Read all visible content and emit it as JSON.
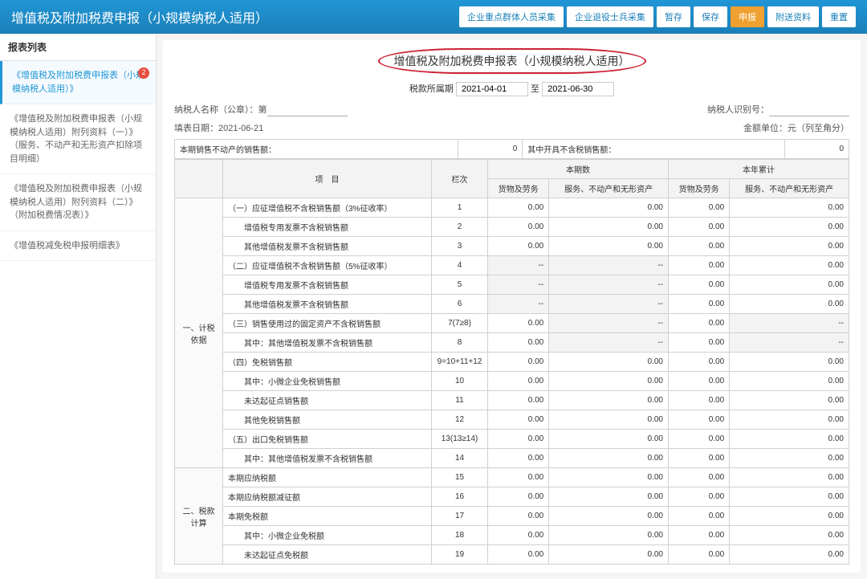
{
  "header": {
    "title": "增值税及附加税费申报（小规模纳税人适用）",
    "actions": [
      "企业重点群体人员采集",
      "企业退役士兵采集",
      "暂存",
      "保存",
      "申报",
      "附送资料",
      "重置"
    ]
  },
  "sidebar": {
    "head": "报表列表",
    "items": [
      {
        "label": "《增值税及附加税费申报表（小规模纳税人适用）》",
        "active": true,
        "badge": "2"
      },
      {
        "label": "《增值税及附加税费申报表（小规模纳税人适用）附列资料（一）》（服务、不动产和无形资产扣除项目明细）"
      },
      {
        "label": "《增值税及附加税费申报表（小规模纳税人适用）附列资料（二）》（附加税费情况表）》"
      },
      {
        "label": "《增值税减免税申报明细表》"
      }
    ]
  },
  "form": {
    "title": "增值税及附加税费申报表（小规模纳税人适用）",
    "period_label": "税款所属期",
    "period_from": "2021-04-01",
    "to": "至",
    "period_to": "2021-06-30",
    "taxpayer_name_label": "纳税人名称（公章）：第",
    "taxpayer_name": "",
    "taxpayer_id_label": "纳税人识别号：",
    "fill_date_label": "填表日期：",
    "fill_date": "2021-06-21",
    "unit_label": "金额单位：元（列至角分）"
  },
  "table": {
    "top_labels": {
      "a": "本期销售不动产的销售额：",
      "b": "其中开具不含税销售额：",
      "col_item": "项　目",
      "col_lane": "栏次",
      "col_cur": "本期数",
      "col_year": "本年累计",
      "sub1": "货物及劳务",
      "sub2": "服务、不动产和无形资产"
    },
    "top_vals": {
      "a": "0",
      "b": "0"
    },
    "cats": {
      "c1": "一、计税依据",
      "c2": "二、税款计算"
    }
  },
  "chart_data": {
    "type": "table",
    "columns": [
      "项目",
      "栏次",
      "本期-货物及劳务",
      "本期-服务不动产无形资产",
      "本年累计-货物及劳务",
      "本年累计-服务不动产无形资产"
    ],
    "rows": [
      {
        "name": "（一）应征增值税不含税销售额（3%征收率）",
        "lane": "1",
        "v": [
          "0.00",
          "0.00",
          "0.00",
          "0.00"
        ]
      },
      {
        "name": "　　增值税专用发票不含税销售额",
        "lane": "2",
        "v": [
          "0.00",
          "0.00",
          "0.00",
          "0.00"
        ]
      },
      {
        "name": "　　其他增值税发票不含税销售额",
        "lane": "3",
        "v": [
          "0.00",
          "0.00",
          "0.00",
          "0.00"
        ]
      },
      {
        "name": "（二）应征增值税不含税销售额（5%征收率）",
        "lane": "4",
        "v": [
          "--",
          "--",
          "0.00",
          "0.00"
        ]
      },
      {
        "name": "　　增值税专用发票不含税销售额",
        "lane": "5",
        "v": [
          "--",
          "--",
          "0.00",
          "0.00"
        ]
      },
      {
        "name": "　　其他增值税发票不含税销售额",
        "lane": "6",
        "v": [
          "--",
          "--",
          "0.00",
          "0.00"
        ]
      },
      {
        "name": "（三）销售使用过的固定资产不含税销售额",
        "lane": "7(7≥8)",
        "v": [
          "0.00",
          "--",
          "0.00",
          "--"
        ]
      },
      {
        "name": "　　其中：其他增值税发票不含税销售额",
        "lane": "8",
        "v": [
          "0.00",
          "--",
          "0.00",
          "--"
        ]
      },
      {
        "name": "（四）免税销售额",
        "lane": "9=10+11+12",
        "v": [
          "0.00",
          "0.00",
          "0.00",
          "0.00"
        ]
      },
      {
        "name": "　　其中：小微企业免税销售额",
        "lane": "10",
        "v": [
          "0.00",
          "0.00",
          "0.00",
          "0.00"
        ]
      },
      {
        "name": "　　未达起征点销售额",
        "lane": "11",
        "v": [
          "0.00",
          "0.00",
          "0.00",
          "0.00"
        ]
      },
      {
        "name": "　　其他免税销售额",
        "lane": "12",
        "v": [
          "0.00",
          "0.00",
          "0.00",
          "0.00"
        ]
      },
      {
        "name": "（五）出口免税销售额",
        "lane": "13(13≥14)",
        "v": [
          "0.00",
          "0.00",
          "0.00",
          "0.00"
        ]
      },
      {
        "name": "　　其中：其他增值税发票不含税销售额",
        "lane": "14",
        "v": [
          "0.00",
          "0.00",
          "0.00",
          "0.00"
        ]
      },
      {
        "name": "本期应纳税额",
        "lane": "15",
        "v": [
          "0.00",
          "0.00",
          "0.00",
          "0.00"
        ]
      },
      {
        "name": "本期应纳税额减征额",
        "lane": "16",
        "v": [
          "0.00",
          "0.00",
          "0.00",
          "0.00"
        ]
      },
      {
        "name": "本期免税额",
        "lane": "17",
        "v": [
          "0.00",
          "0.00",
          "0.00",
          "0.00"
        ]
      },
      {
        "name": "　　其中：小微企业免税额",
        "lane": "18",
        "v": [
          "0.00",
          "0.00",
          "0.00",
          "0.00"
        ]
      },
      {
        "name": "　　未达起征点免税额",
        "lane": "19",
        "v": [
          "0.00",
          "0.00",
          "0.00",
          "0.00"
        ]
      }
    ]
  }
}
